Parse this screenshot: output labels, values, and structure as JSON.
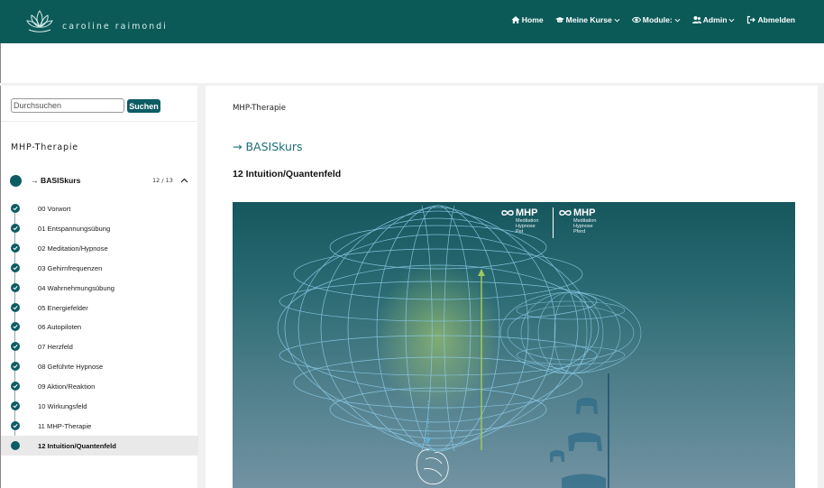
{
  "header": {
    "brand_name": "caroline raimondi",
    "nav": [
      {
        "label": "Home",
        "icon": "home-icon",
        "has_dropdown": false
      },
      {
        "label": "Meine Kurse",
        "icon": "graduation-cap-icon",
        "has_dropdown": true
      },
      {
        "label": "Module:",
        "icon": "eye-icon",
        "has_dropdown": true
      },
      {
        "label": "Admin",
        "icon": "users-icon",
        "has_dropdown": true
      },
      {
        "label": "Abmelden",
        "icon": "logout-icon",
        "has_dropdown": false
      }
    ]
  },
  "sidebar": {
    "search": {
      "placeholder": "Durchsuchen",
      "value": "",
      "button_label": "Suchen"
    },
    "title": "MHP-Therapie",
    "course": {
      "name": "→ BASISkurs",
      "progress": "12 / 13",
      "expanded": true
    },
    "lessons": [
      {
        "label": "00 Vorwort",
        "completed": true,
        "active": false
      },
      {
        "label": "01 Entspannungsübung",
        "completed": true,
        "active": false
      },
      {
        "label": "02 Meditation/Hypnose",
        "completed": true,
        "active": false
      },
      {
        "label": "03 Gehirnfrequenzen",
        "completed": true,
        "active": false
      },
      {
        "label": "04 Wahrnehmungsübung",
        "completed": true,
        "active": false
      },
      {
        "label": "05 Energiefelder",
        "completed": true,
        "active": false
      },
      {
        "label": "06 Autopiloten",
        "completed": true,
        "active": false
      },
      {
        "label": "07 Herzfeld",
        "completed": true,
        "active": false
      },
      {
        "label": "08 Geführte Hypnose",
        "completed": true,
        "active": false
      },
      {
        "label": "09 Aktion/Reaktion",
        "completed": true,
        "active": false
      },
      {
        "label": "10 Wirkungsfeld",
        "completed": true,
        "active": false
      },
      {
        "label": "11 MHP-Therapie",
        "completed": true,
        "active": false
      },
      {
        "label": "12 Intuition/Quantenfeld",
        "completed": false,
        "active": true
      }
    ]
  },
  "main": {
    "breadcrumb": "MHP-Therapie",
    "section": "→ BASISkurs",
    "lesson_title": "12 Intuition/Quantenfeld",
    "media": {
      "logos": [
        {
          "name": "MHP",
          "lines": [
            "Meditation",
            "Hypnose",
            "Pet"
          ]
        },
        {
          "name": "MHP",
          "lines": [
            "Meditation",
            "Hypnose",
            "Pferd"
          ]
        }
      ]
    }
  },
  "colors": {
    "header_bg": "#0b5a58",
    "accent": "#0c5c64",
    "link": "#1d6f75"
  }
}
